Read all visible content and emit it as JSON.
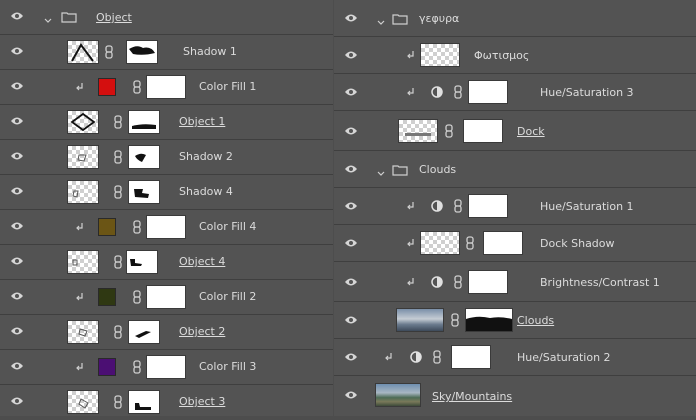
{
  "left_panel": {
    "layers": [
      {
        "name": "Object",
        "kind": "group",
        "underline": true
      },
      {
        "name": "Shadow 1",
        "kind": "layer_mask",
        "thumb": "diamond-dark"
      },
      {
        "name": "Color Fill 1",
        "kind": "fill",
        "color": "#d40f0f"
      },
      {
        "name": "Object 1",
        "kind": "layer_mask",
        "thumb": "diamond",
        "underline": true
      },
      {
        "name": "Shadow 2",
        "kind": "layer_mask",
        "thumb": "small"
      },
      {
        "name": "Shadow 4",
        "kind": "layer_mask",
        "thumb": "small"
      },
      {
        "name": "Color Fill 4",
        "kind": "fill",
        "color": "#6b5515"
      },
      {
        "name": "Object 4",
        "kind": "layer_mask",
        "thumb": "small",
        "underline": true
      },
      {
        "name": "Color Fill 2",
        "kind": "fill",
        "color": "#2f3812"
      },
      {
        "name": "Object 2",
        "kind": "layer_mask",
        "thumb": "small",
        "underline": true
      },
      {
        "name": "Color Fill 3",
        "kind": "fill",
        "color": "#4b0f73"
      },
      {
        "name": "Object 3",
        "kind": "layer_mask",
        "thumb": "small",
        "underline": true
      }
    ]
  },
  "right_panel": {
    "layers": [
      {
        "name": "γεφυρα",
        "kind": "group"
      },
      {
        "name": "Φωτισμος",
        "kind": "clipped_pixel"
      },
      {
        "name": "Hue/Saturation 3",
        "kind": "adjustment"
      },
      {
        "name": "Dock",
        "kind": "layer_mask",
        "underline": true
      },
      {
        "name": "Clouds",
        "kind": "group"
      },
      {
        "name": "Hue/Saturation 1",
        "kind": "adjustment"
      },
      {
        "name": "Dock Shadow",
        "kind": "clipped_pixel_mask"
      },
      {
        "name": "Brightness/Contrast 1",
        "kind": "adjustment"
      },
      {
        "name": "Clouds",
        "kind": "image_mask",
        "underline": true
      },
      {
        "name": "Hue/Saturation 2",
        "kind": "adjustment"
      },
      {
        "name": "Sky/Mountains",
        "kind": "image",
        "underline": true
      }
    ]
  },
  "icons": {
    "visibility": "eye-icon",
    "group": "folder-icon",
    "expand": "chevron-down-icon",
    "link": "chain-link-icon",
    "clip": "clipping-arrow-icon",
    "adjustment": "half-circle-icon"
  },
  "colors": {
    "panel_bg": "#535353",
    "divider": "#3f3f3f",
    "text": "#dcdcdc"
  }
}
